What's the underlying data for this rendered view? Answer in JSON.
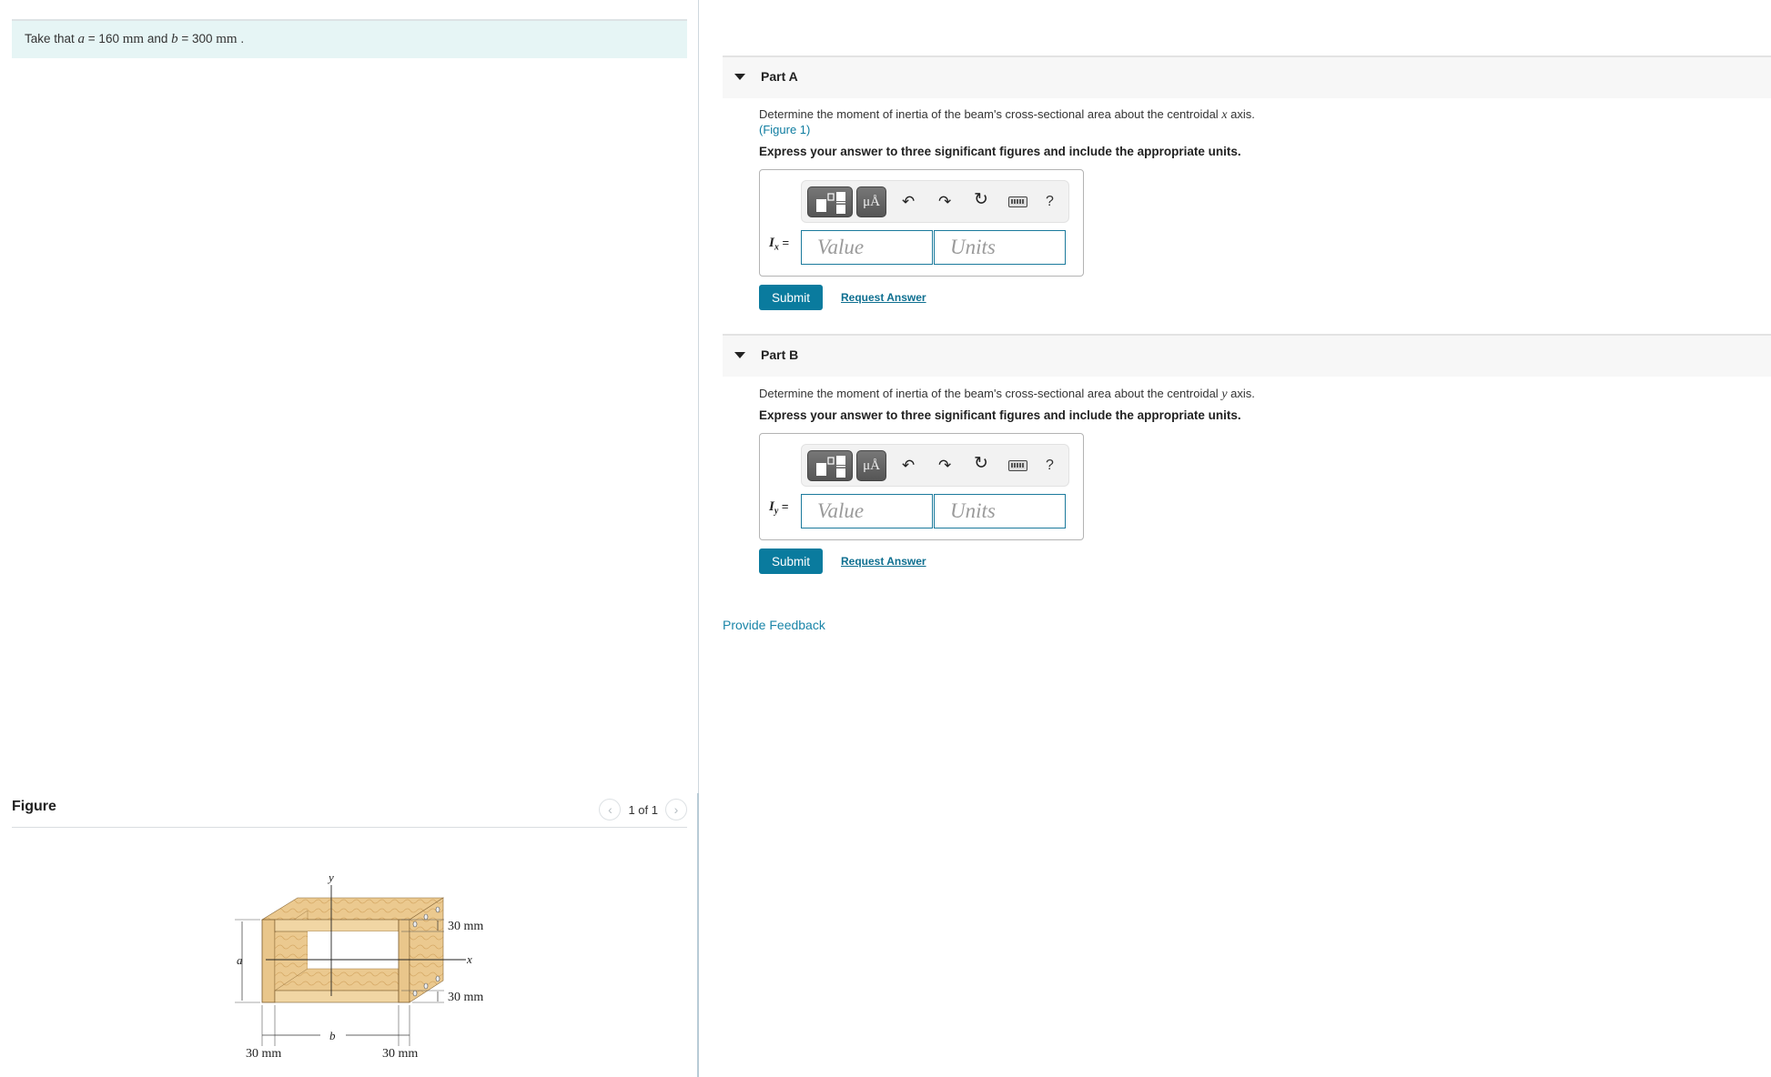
{
  "info": {
    "prefix": "Take that ",
    "var_a": "a",
    "eq1": " = 160 ",
    "unit1": "mm",
    "mid": " and ",
    "var_b": "b",
    "eq2": " = 300 ",
    "unit2": "mm",
    "suffix": " ."
  },
  "figure": {
    "title": "Figure",
    "pager_text": "1 of 1",
    "prev_icon": "‹",
    "next_icon": "›",
    "labels": {
      "y_axis": "y",
      "x_axis": "x",
      "a": "a",
      "b": "b",
      "top_thickness": "30 mm",
      "bottom_thickness": "30 mm",
      "left_thickness": "30 mm",
      "right_thickness": "30 mm"
    },
    "colors": {
      "wood": "#e8c48a",
      "wood_dark": "#c99a55",
      "wood_light": "#f1d7a6"
    }
  },
  "parts": [
    {
      "title": "Part A",
      "prompt_pre": "Determine the moment of inertia of the beam's cross-sectional area about the centroidal ",
      "prompt_axis": "x",
      "prompt_post": " axis.",
      "figure_link": "(Figure 1)",
      "instruction": "Express your answer to three significant figures and include the appropriate units.",
      "var_symbol": "I",
      "var_sub": "x",
      "eq": " =",
      "value_placeholder": "Value",
      "units_placeholder": "Units",
      "units_button": "μÅ",
      "submit_label": "Submit",
      "request_label": "Request Answer"
    },
    {
      "title": "Part B",
      "prompt_pre": "Determine the moment of inertia of the beam's cross-sectional area about the centroidal ",
      "prompt_axis": "y",
      "prompt_post": " axis.",
      "instruction": "Express your answer to three significant figures and include the appropriate units.",
      "var_symbol": "I",
      "var_sub": "y",
      "eq": " =",
      "value_placeholder": "Value",
      "units_placeholder": "Units",
      "units_button": "μÅ",
      "submit_label": "Submit",
      "request_label": "Request Answer"
    }
  ],
  "toolbar_icons": {
    "undo": "↶",
    "redo": "↷",
    "reset": "↻",
    "help": "?"
  },
  "feedback_label": "Provide Feedback",
  "colors": {
    "accent": "#0a7b9e",
    "link": "#0e7ca0",
    "info_bg": "#e6f5f5",
    "part_header_bg": "#f7f7f7"
  }
}
